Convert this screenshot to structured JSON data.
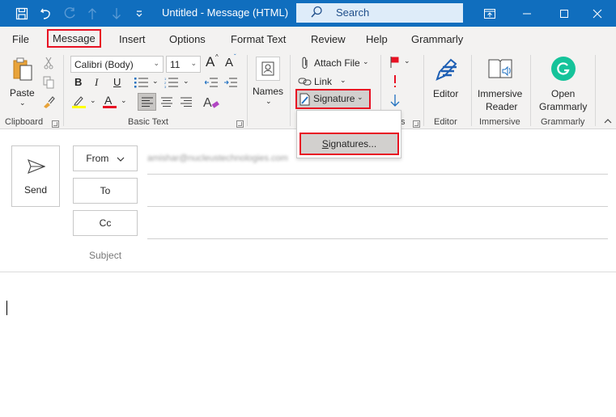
{
  "titlebar": {
    "title": "Untitled  -  Message (HTML)",
    "search_placeholder": "Search",
    "quick_access": [
      "save-icon",
      "undo-icon",
      "redo-icon",
      "previous-item-icon",
      "next-item-icon",
      "customize-toolbar-icon"
    ],
    "window_controls": [
      "ribbon-display-icon",
      "minimize-icon",
      "maximize-icon",
      "close-icon"
    ]
  },
  "tabs": [
    {
      "label": "File"
    },
    {
      "label": "Message",
      "selected": true
    },
    {
      "label": "Insert"
    },
    {
      "label": "Options"
    },
    {
      "label": "Format Text"
    },
    {
      "label": "Review"
    },
    {
      "label": "Help"
    },
    {
      "label": "Grammarly"
    }
  ],
  "ribbon": {
    "clipboard": {
      "paste_label": "Paste",
      "group_label": "Clipboard"
    },
    "basic_text": {
      "font_name": "Calibri (Body)",
      "font_size": "11",
      "bold": "B",
      "italic": "I",
      "underline": "U",
      "grow_font": "A",
      "shrink_font": "A",
      "font_color_glyph": "A",
      "group_label": "Basic Text",
      "highlight_color": "#ffff00",
      "font_color": "#e81123"
    },
    "names": {
      "label": "Names"
    },
    "include": {
      "attach_file": "Attach File",
      "link": "Link",
      "signature": "Signature"
    },
    "tags": {
      "group_label_fragment": "s"
    },
    "editor": {
      "label": "Editor",
      "group_label": "Editor"
    },
    "immersive": {
      "label_line1": "Immersive",
      "label_line2": "Reader",
      "group_label": "Immersive"
    },
    "grammarly": {
      "label_line1": "Open",
      "label_line2": "Grammarly",
      "group_label": "Grammarly",
      "brand_color": "#15c39a"
    }
  },
  "signature_menu": {
    "items": [
      {
        "label": "Signatures...",
        "accelerator": "S",
        "highlighted": true
      }
    ]
  },
  "compose": {
    "send_label": "Send",
    "from_label": "From",
    "from_value": "amishar@nucleustechnologies.com",
    "to_label": "To",
    "to_value": "",
    "cc_label": "Cc",
    "cc_value": "",
    "subject_label": "Subject",
    "subject_value": "",
    "body": ""
  },
  "colors": {
    "titlebar": "#106ebe",
    "highlight_box": "#e81123",
    "ribbon_bg": "#f3f2f1"
  }
}
